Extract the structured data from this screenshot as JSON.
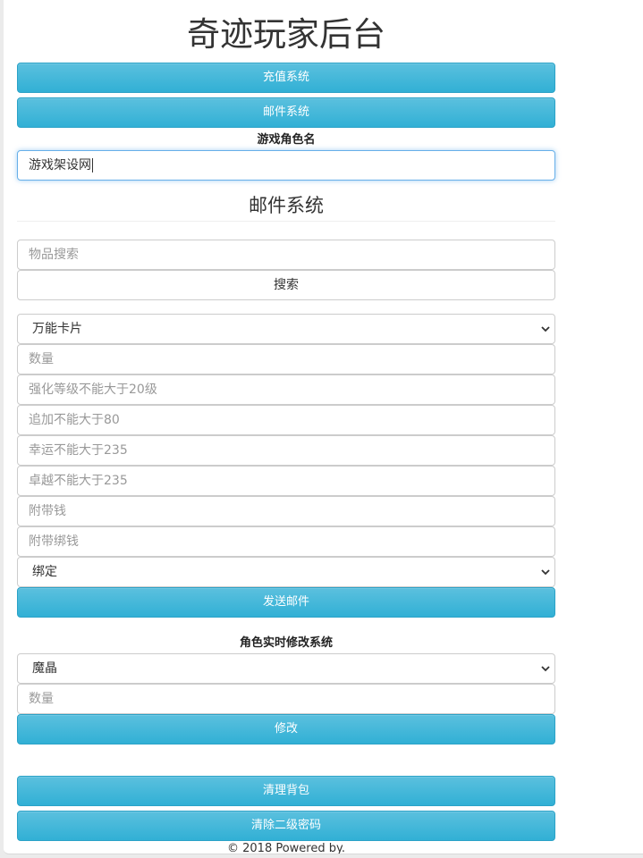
{
  "header": {
    "title": "奇迹玩家后台"
  },
  "nav": {
    "recharge_label": "充值系统",
    "mail_label": "邮件系统"
  },
  "character": {
    "label": "游戏角色名",
    "value": "游戏架设网"
  },
  "mail": {
    "heading": "邮件系统",
    "item_search_placeholder": "物品搜索",
    "search_button": "搜索",
    "item_select_value": "万能卡片",
    "quantity_placeholder": "数量",
    "enhance_placeholder": "强化等级不能大于20级",
    "additional_placeholder": "追加不能大于80",
    "luck_placeholder": "幸运不能大于235",
    "excellent_placeholder": "卓越不能大于235",
    "money_placeholder": "附带钱",
    "bound_money_placeholder": "附带绑钱",
    "bind_select_value": "绑定",
    "send_button": "发送邮件"
  },
  "modify": {
    "label": "角色实时修改系统",
    "resource_select_value": "魔晶",
    "quantity_placeholder": "数量",
    "modify_button": "修改"
  },
  "actions": {
    "clear_bag": "清理背包",
    "clear_secondary_password": "清除二级密码"
  },
  "footer": {
    "text": "© 2018 Powered by."
  },
  "colors": {
    "button_accent": "#5bc0de",
    "focus_border": "#66afe9"
  }
}
